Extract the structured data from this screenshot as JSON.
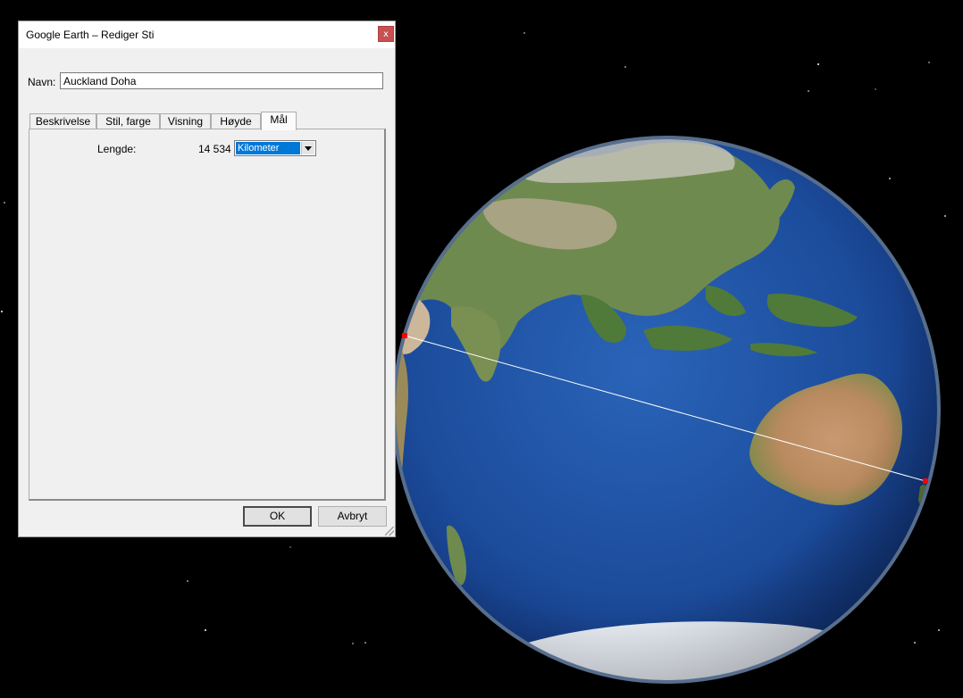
{
  "window": {
    "title": "Google Earth – Rediger Sti",
    "close_glyph": "x"
  },
  "name_field": {
    "label": "Navn:",
    "value": "Auckland Doha"
  },
  "tabs": [
    {
      "label": "Beskrivelse"
    },
    {
      "label": "Stil, farge"
    },
    {
      "label": "Visning"
    },
    {
      "label": "Høyde"
    },
    {
      "label": "Mål",
      "active": true
    }
  ],
  "measure": {
    "length_label": "Lengde:",
    "length_value": "14 534",
    "unit_selected": "Kilometer"
  },
  "buttons": {
    "ok": "OK",
    "cancel": "Avbryt"
  },
  "map": {
    "path_color": "#ffffff",
    "endpoint_color": "#ff0000",
    "ocean_color": "#1d4fa0",
    "atmosphere_color": "#9ec9ff"
  }
}
